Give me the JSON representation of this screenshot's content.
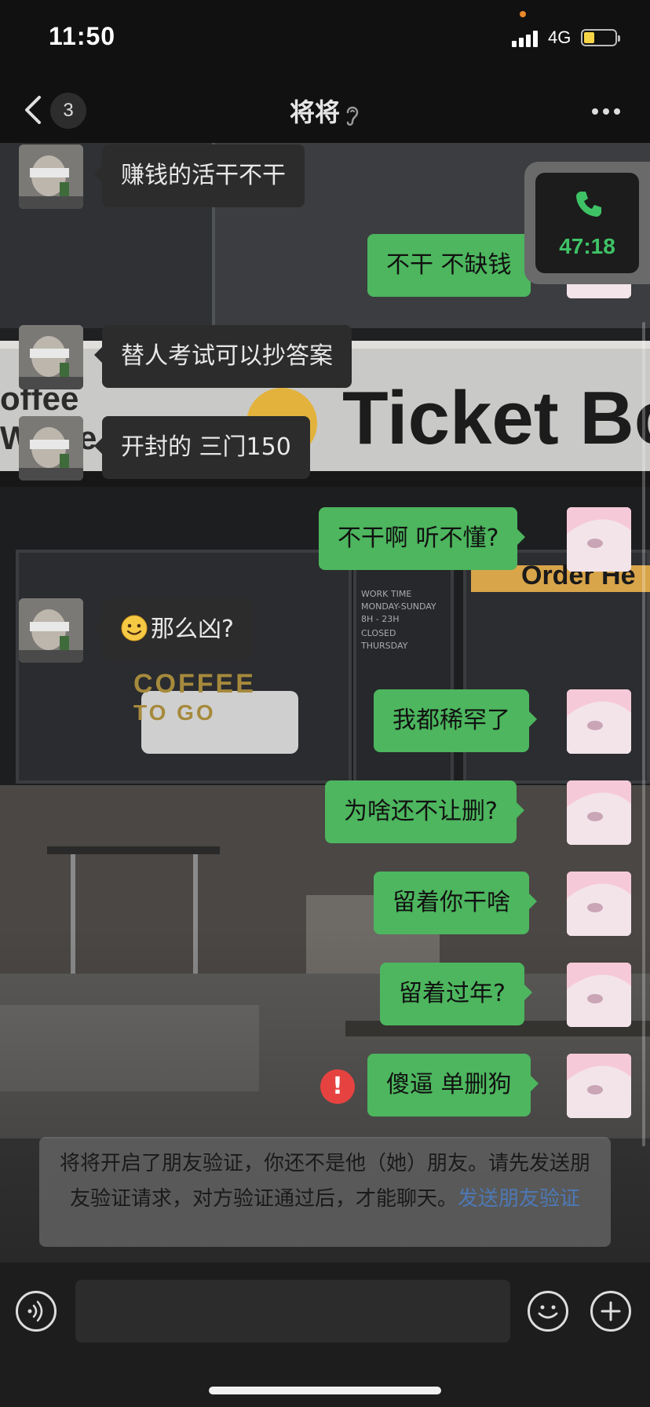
{
  "status_bar": {
    "time": "11:50",
    "network": "4G"
  },
  "nav": {
    "back_badge": "3",
    "title": "将将"
  },
  "call": {
    "duration": "47:18"
  },
  "background": {
    "sign_left_1": "offee",
    "sign_left_2": "W",
    "sign_left_3": "e",
    "sign_ticket": "Ticket Bo",
    "sign_order": "Order He",
    "window_text_1": "WORK TIME",
    "window_text_2": "MONDAY-SUNDAY",
    "window_text_3": "8H - 23H",
    "window_text_4": "CLOSED",
    "window_text_5": "THURSDAY",
    "coffee_1": "COFFEE",
    "coffee_2": "TO GO"
  },
  "messages": [
    {
      "side": "in",
      "text": "赚钱的活干不干"
    },
    {
      "side": "out",
      "text": "不干 不缺钱"
    },
    {
      "side": "in",
      "text": "替人考试可以抄答案"
    },
    {
      "side": "in",
      "text": "开封的 三门150"
    },
    {
      "side": "out",
      "text": "不干啊 听不懂?"
    },
    {
      "side": "in",
      "text": "那么凶?",
      "emoji": "smile"
    },
    {
      "side": "out",
      "text": "我都稀罕了"
    },
    {
      "side": "out",
      "text": "为啥还不让删?"
    },
    {
      "side": "out",
      "text": "留着你干啥"
    },
    {
      "side": "out",
      "text": "留着过年?"
    },
    {
      "side": "out",
      "text": "傻逼 单删狗",
      "failed": true
    }
  ],
  "error_mark": "!",
  "notice": {
    "text": "将将开启了朋友验证，你还不是他（她）朋友。请先发送朋友验证请求，对方验证通过后，才能聊天。",
    "link": "发送朋友验证"
  },
  "input": {
    "value": "",
    "placeholder": ""
  },
  "icons": {
    "back": "chevron-left-icon",
    "ear": "ear-icon",
    "more": "more-dots-icon",
    "phone": "phone-icon",
    "voice": "voice-icon",
    "emoji": "emoji-icon",
    "plus": "plus-icon"
  },
  "colors": {
    "outgoing_bubble": "#4db65e",
    "incoming_bubble": "#2c2c2c",
    "call_green": "#3fc266",
    "error_red": "#e64340",
    "link_blue": "#4d79b5"
  }
}
